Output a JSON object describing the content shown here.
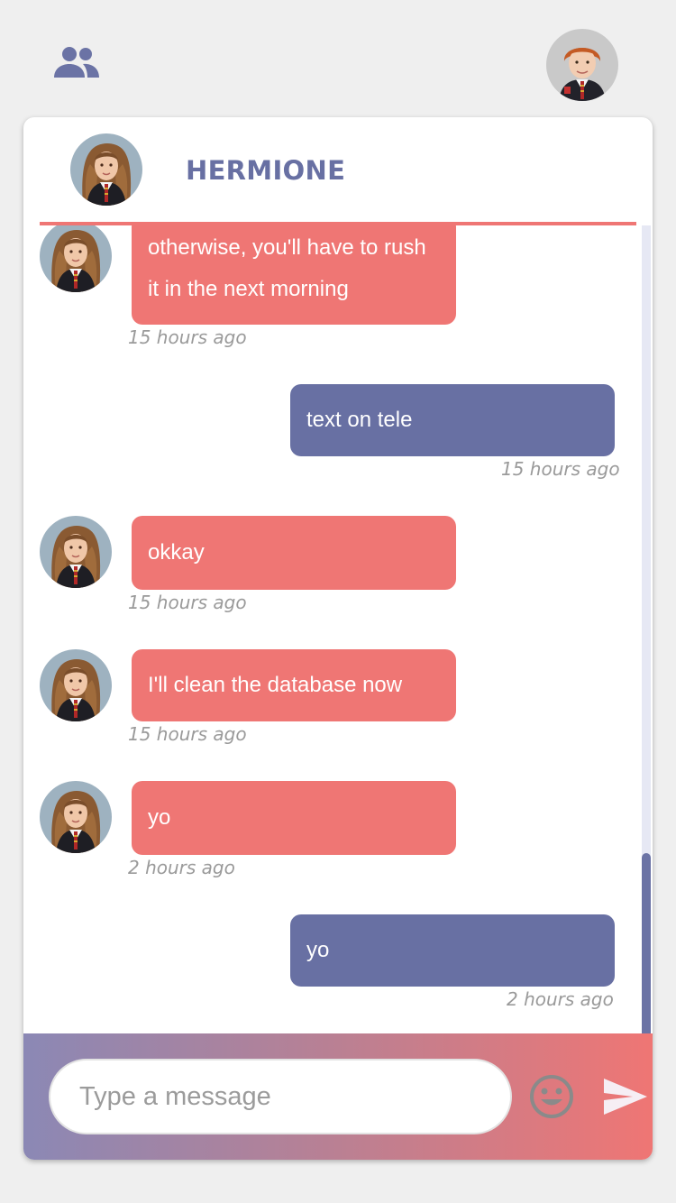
{
  "header": {
    "friends_icon": "people-icon",
    "user_avatar": "avatar-photo"
  },
  "chat": {
    "contact_name": "HERMIONE",
    "messages": [
      {
        "side": "in",
        "lines": [
          "otherwise, you'll have to rush",
          "it in the next morning"
        ],
        "time": "15 hours ago"
      },
      {
        "side": "out",
        "lines": [
          "text on tele"
        ],
        "time": "15 hours ago"
      },
      {
        "side": "in",
        "lines": [
          "okkay"
        ],
        "time": "15 hours ago"
      },
      {
        "side": "in",
        "lines": [
          "I'll clean the database now"
        ],
        "time": "15 hours ago"
      },
      {
        "side": "in",
        "lines": [
          "yo"
        ],
        "time": "2 hours ago"
      },
      {
        "side": "out",
        "lines": [
          "yo"
        ],
        "time": "2 hours ago"
      }
    ]
  },
  "composer": {
    "placeholder": "Type a message",
    "emoji_icon": "smiley-icon",
    "send_icon": "send-icon"
  },
  "colors": {
    "incoming": "#ef7674",
    "outgoing": "#6870a3",
    "accent": "#6870a3",
    "background": "#efefef"
  }
}
